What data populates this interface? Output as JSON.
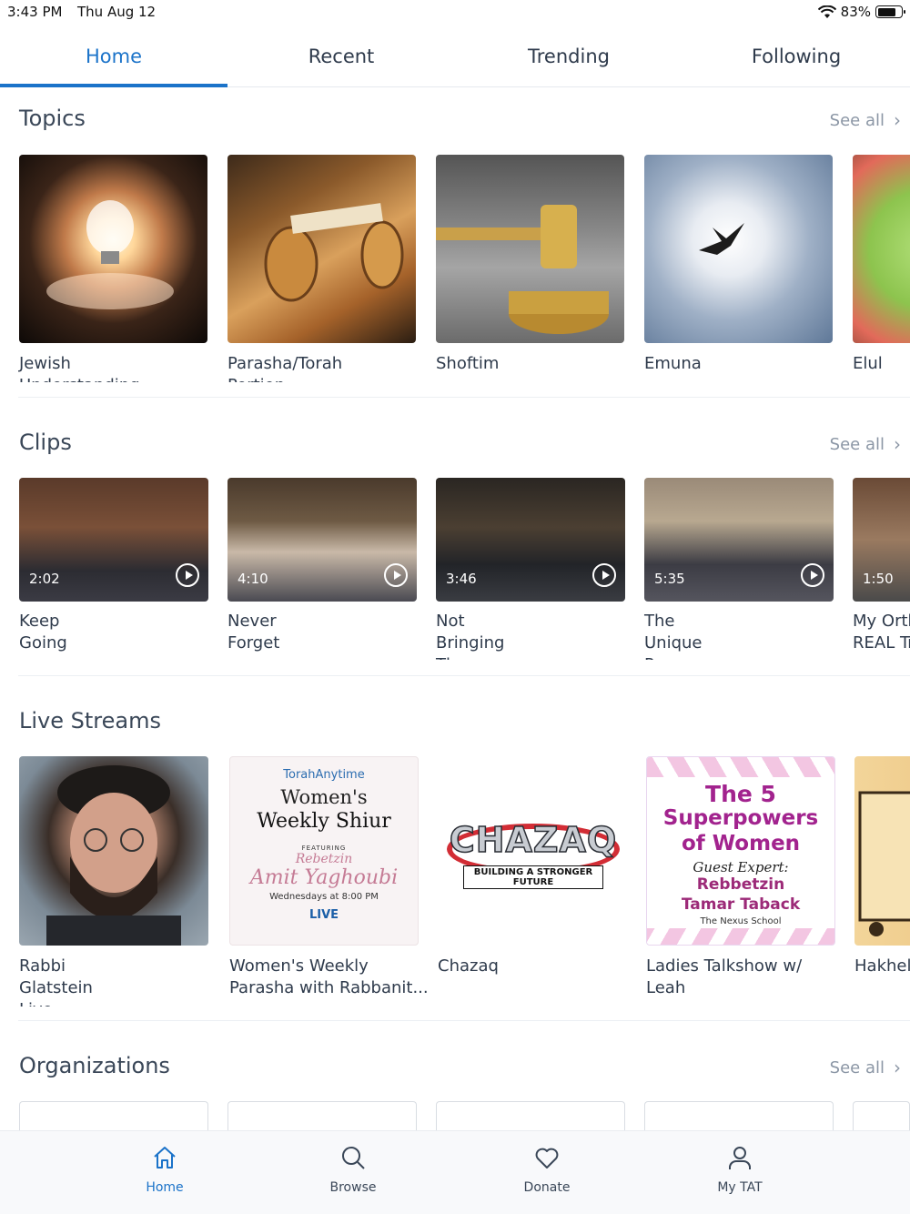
{
  "status_bar": {
    "time": "3:43 PM",
    "date": "Thu Aug 12",
    "battery": "83%",
    "battery_level": 0.83
  },
  "tabs": [
    {
      "label": "Home",
      "active": true
    },
    {
      "label": "Recent",
      "active": false
    },
    {
      "label": "Trending",
      "active": false
    },
    {
      "label": "Following",
      "active": false
    }
  ],
  "colors": {
    "accent": "#1b73c9",
    "text": "#2f3b4c",
    "muted": "#8b96a5"
  },
  "topics": {
    "title": "Topics",
    "see_all": "See all",
    "items": [
      {
        "label": "Jewish Understanding",
        "image": "lightbulb-in-hands"
      },
      {
        "label": "Parasha/Torah Portion",
        "image": "torah-scroll"
      },
      {
        "label": "Shoftim",
        "image": "gavel"
      },
      {
        "label": "Emuna",
        "image": "bird-in-clouds"
      },
      {
        "label": "Elul",
        "image": "apples-and-honey"
      }
    ]
  },
  "clips": {
    "title": "Clips",
    "see_all": "See all",
    "items": [
      {
        "label": "Keep Going",
        "duration": "2:02"
      },
      {
        "label": "Never Forget",
        "duration": "4:10"
      },
      {
        "label": "Not Bringing The Guilt",
        "duration": "3:46"
      },
      {
        "label": "The Unique Prayer",
        "duration": "5:35"
      },
      {
        "label": "My Orth",
        "label_line2": "REAL Tr",
        "duration": "1:50"
      }
    ]
  },
  "live_streams": {
    "title": "Live Streams",
    "items": [
      {
        "label": "Rabbi Glatstein Live"
      },
      {
        "label": "Women's Weekly",
        "label_line2": "Parasha with Rabbanit...",
        "poster": {
          "brand": "TorahAnytime",
          "line1": "Women's",
          "line2": "Weekly Shiur",
          "featuring": "FEATURING",
          "name1": "Rebetzin",
          "name2": "Amit Yaghoubi",
          "when": "Wednesdays at 8:00 PM",
          "live": "LIVE"
        }
      },
      {
        "label": "Chazaq",
        "poster": {
          "word": "CHAZAQ",
          "tagline": "BUILDING A STRONGER FUTURE"
        }
      },
      {
        "label": "Ladies Talkshow w/",
        "label_line2": "Leah",
        "poster": {
          "l1": "The 5",
          "l2": "Superpowers",
          "l3": "of Women",
          "l4": "Guest Expert:",
          "l5": "Rebbetzin",
          "l6": "Tamar Taback",
          "l7": "The Nexus School"
        }
      },
      {
        "label": "Hakhel"
      }
    ]
  },
  "organizations": {
    "title": "Organizations",
    "see_all": "See all"
  },
  "bottom_nav": [
    {
      "label": "Home",
      "icon": "home-icon",
      "active": true
    },
    {
      "label": "Browse",
      "icon": "search-icon",
      "active": false
    },
    {
      "label": "Donate",
      "icon": "heart-icon",
      "active": false
    },
    {
      "label": "My TAT",
      "icon": "person-icon",
      "active": false
    }
  ]
}
